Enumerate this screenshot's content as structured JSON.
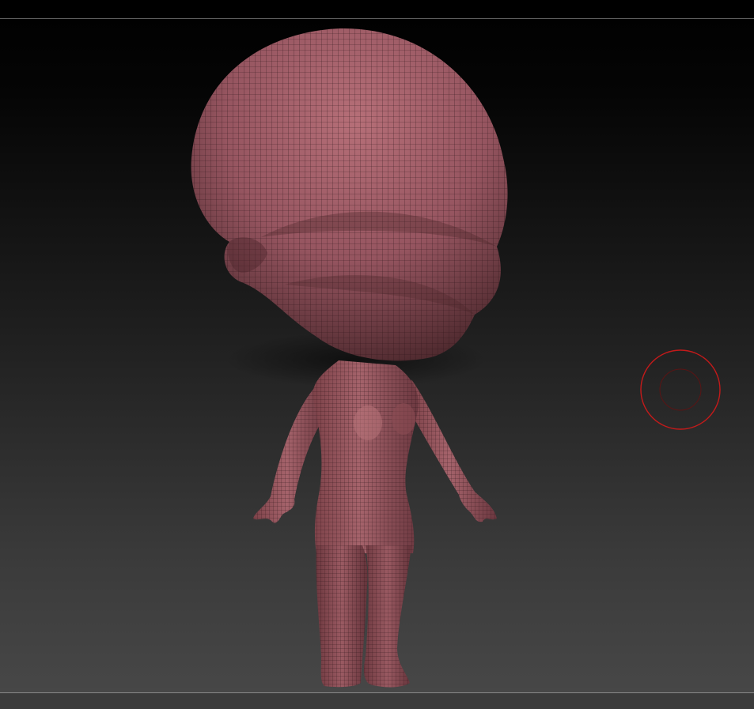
{
  "viewport": {
    "background_top": "#000000",
    "background_bottom": "#474747"
  },
  "model": {
    "name": "chibi-figure",
    "material_color": "#9b5a62",
    "wireframe_color": "#2a1316",
    "polyframe": true
  },
  "cursor": {
    "icon": "brush-cursor-icon",
    "color": "#c41a1a"
  }
}
